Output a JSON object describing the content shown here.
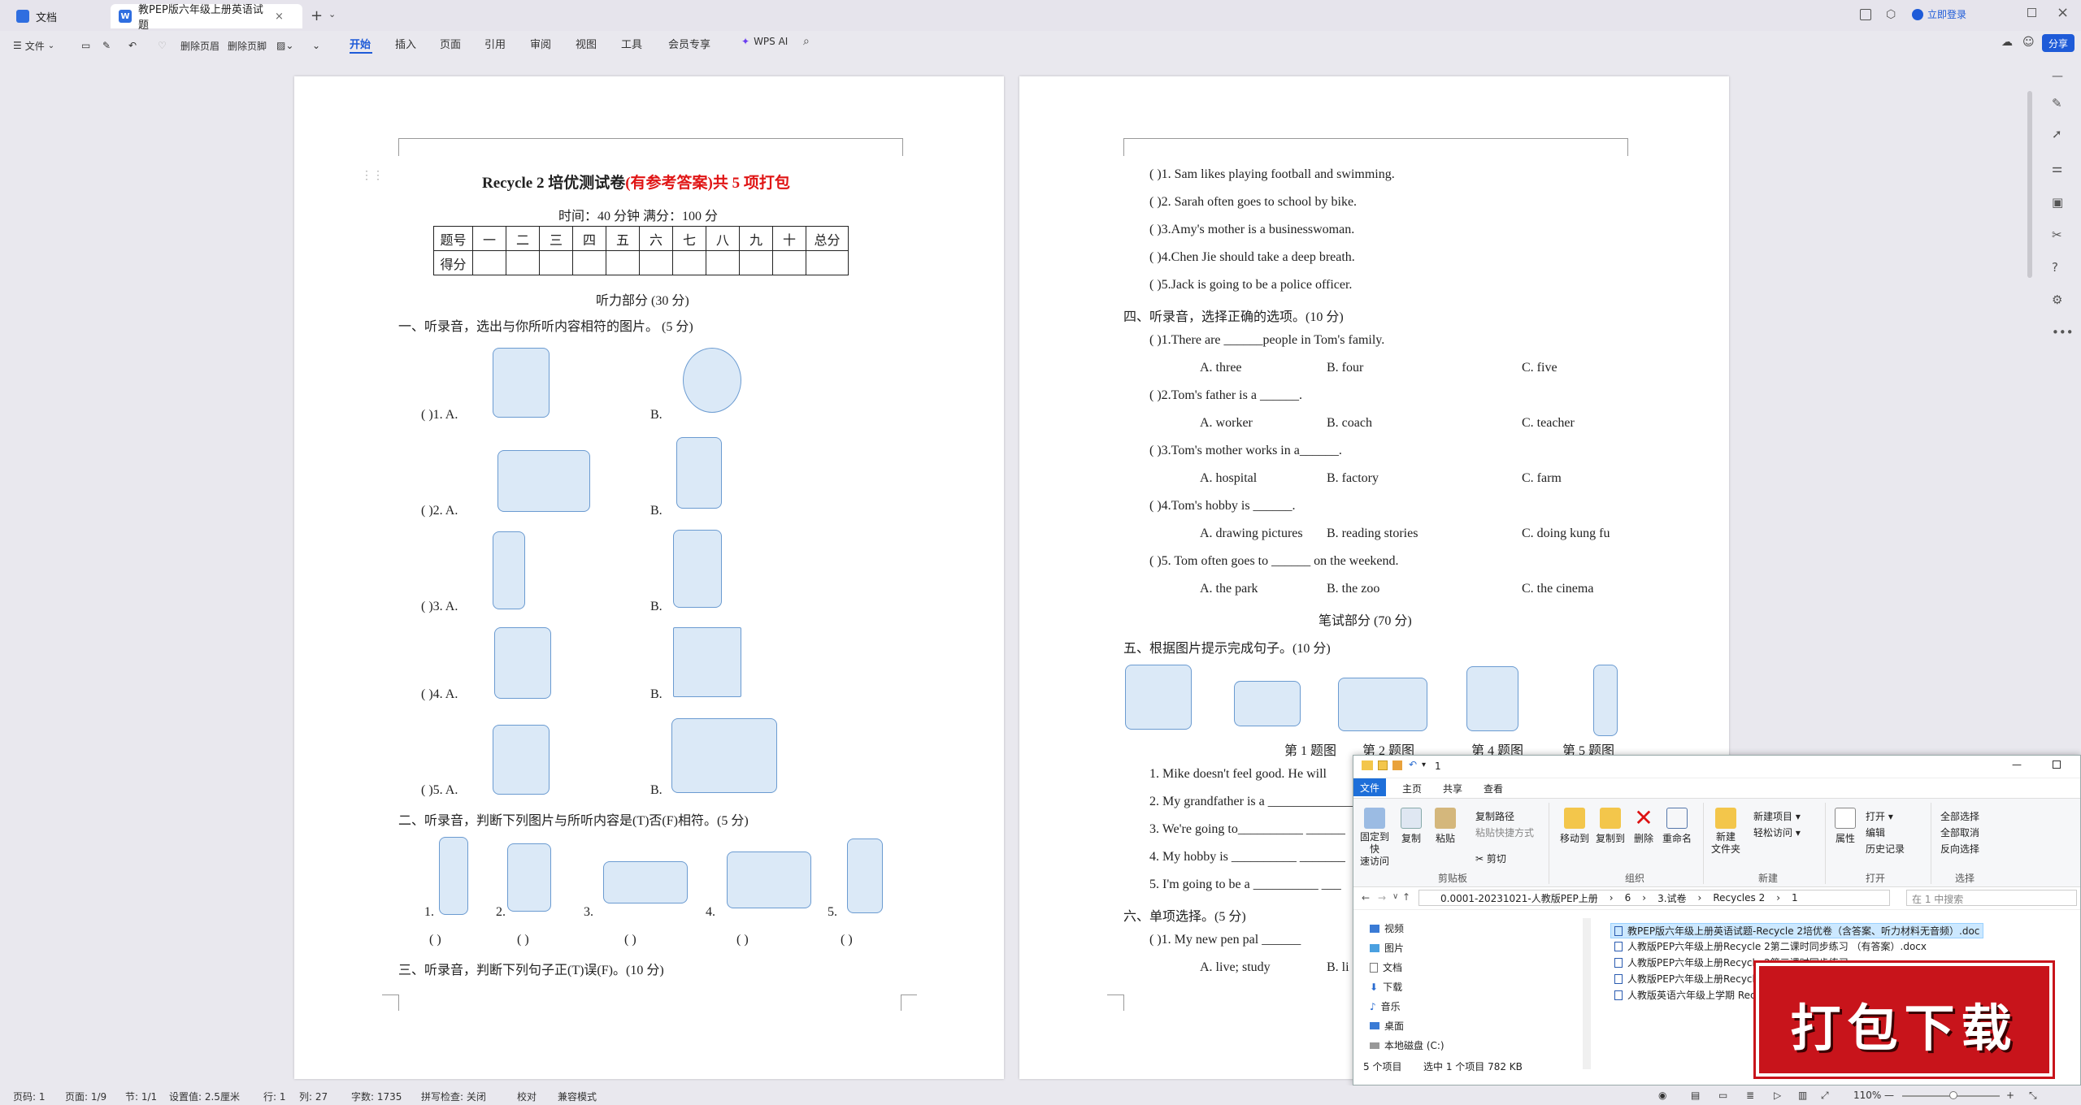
{
  "titlebar": {
    "tabs": [
      {
        "label": "文档"
      },
      {
        "label": "教PEP版六年级上册英语试题"
      }
    ],
    "login_label": "立即登录"
  },
  "toolbar": {
    "file_label": "文件",
    "delete_header": "删除页眉",
    "delete_footer": "删除页脚",
    "ribbon_tabs": [
      "开始",
      "插入",
      "页面",
      "引用",
      "审阅",
      "视图",
      "工具",
      "会员专享"
    ],
    "wps_ai": "WPS AI",
    "share": "分享"
  },
  "page1": {
    "title_black": "Recycle 2 培优测试卷",
    "title_red": "(有参考答案)共 5 项打包",
    "subtitle": "时间：40 分钟    满分：100 分",
    "score_row1": [
      "题号",
      "一",
      "二",
      "三",
      "四",
      "五",
      "六",
      "七",
      "八",
      "九",
      "十",
      "总分"
    ],
    "score_row2": [
      "得分",
      "",
      "",
      "",
      "",
      "",
      "",
      "",
      "",
      "",
      "",
      ""
    ],
    "listening": "听力部分 (30 分)",
    "section1": "一、听录音，选出与你所听内容相符的图片。 (5 分)",
    "q_labels": [
      {
        "a": "(      )1. A.",
        "b": "B."
      },
      {
        "a": "(      )2. A.",
        "b": "B."
      },
      {
        "a": "(      )3. A.",
        "b": "B."
      },
      {
        "a": "(      )4. A.",
        "b": "B."
      },
      {
        "a": "(      )5. A.",
        "b": "B."
      }
    ],
    "section2": "二、听录音，判断下列图片与所听内容是(T)否(F)相符。(5 分)",
    "s2_nums": [
      "1.",
      "2.",
      "3.",
      "4.",
      "5."
    ],
    "s2_paren": "(      )",
    "section3": "三、听录音，判断下列句子正(T)误(F)。(10 分)"
  },
  "page2": {
    "tf": [
      "(        )1. Sam likes playing football and swimming.",
      "(        )2. Sarah often goes to school by bike.",
      "(        )3.Amy's mother is a businesswoman.",
      "(        )4.Chen Jie should take a deep breath.",
      "(        )5.Jack is going to be a police officer."
    ],
    "section4": "四、听录音，选择正确的选项。(10 分)",
    "mc": [
      {
        "q": "(        )1.There are ______people in Tom's family.",
        "a": "A. three",
        "b": "B. four",
        "c": "C. five"
      },
      {
        "q": "(        )2.Tom's father is a ______.",
        "a": "A. worker",
        "b": "B. coach",
        "c": "C. teacher"
      },
      {
        "q": "(        )3.Tom's mother works in a______.",
        "a": "A. hospital",
        "b": "B. factory",
        "c": "C. farm"
      },
      {
        "q": "(        )4.Tom's hobby is ______.",
        "a": "A. drawing pictures",
        "b": "B. reading stories",
        "c": "C. doing kung fu"
      },
      {
        "q": "(        )5. Tom often goes to ______ on the weekend.",
        "a": "A. the park",
        "b": "B. the zoo",
        "c": "C. the cinema"
      }
    ],
    "written": "笔试部分    (70 分)",
    "section5": "五、根据图片提示完成句子。(10 分)",
    "pic_labels": [
      "第 1 题图",
      "第 2 题图",
      "第 4 题图",
      "第 5 题图"
    ],
    "sentences": [
      "1. Mike doesn't feel good. He will",
      "2. My grandfather is a ______________",
      "3. We're going to__________ ______",
      "4. My hobby is __________ _______",
      "5. I'm going to be a __________ ___"
    ],
    "section6": "六、单项选择。(5 分)",
    "s6_q1": "(        )1. My new pen pal ______",
    "s6_opts": [
      "A. live; study",
      "B. li"
    ]
  },
  "explorer": {
    "path_num": "1",
    "tabs": [
      "文件",
      "主页",
      "共享",
      "查看"
    ],
    "buttons": {
      "pin": "固定到快\n速访问",
      "copy": "复制",
      "paste": "粘贴",
      "copy_path": "复制路径",
      "paste_shortcut": "粘贴快捷方式",
      "cut": "剪切",
      "move_to": "移动到",
      "copy_to": "复制到",
      "delete": "删除",
      "rename": "重命名",
      "new_folder": "新建\n文件夹",
      "new_item": "新建项目",
      "easy_access": "轻松访问",
      "properties": "属性",
      "open": "打开",
      "edit": "编辑",
      "history": "历史记录",
      "select_all": "全部选择",
      "select_none": "全部取消",
      "invert": "反向选择"
    },
    "groups": [
      "剪贴板",
      "组织",
      "新建",
      "打开",
      "选择"
    ],
    "address": [
      "0.0001-20231021-人教版PEP上册",
      "6",
      "3.试卷",
      "Recycles 2",
      "1"
    ],
    "search_placeholder": "在 1 中搜索",
    "nav": [
      "视频",
      "图片",
      "文档",
      "下载",
      "音乐",
      "桌面",
      "本地磁盘 (C:)"
    ],
    "files": [
      "教PEP版六年级上册英语试题-Recycle 2培优卷（含答案、听力材料无音频）.doc",
      "人教版PEP六年级上册Recycle 2第二课时同步练习 （有答案）.docx",
      "人教版PEP六年级上册Recycle 2第三课时同步练习",
      "人教版PEP六年级上册Recycle 2",
      "人教版英语六年级上学期 Rec"
    ],
    "status_count": "5 个项目",
    "status_selected": "选中 1 个项目  782 KB"
  },
  "promo": {
    "text": "打包下载"
  },
  "statusbar": {
    "page": "页码: 1",
    "pages": "页面: 1/9",
    "section": "节: 1/1",
    "setting": "设置值: 2.5厘米",
    "row": "行: 1",
    "col": "列: 27",
    "words": "字数: 1735",
    "spell": "拼写检查: 关闭",
    "proof": "校对",
    "compat": "兼容模式",
    "zoom": "110%"
  },
  "colors": {
    "accent": "#1e5bd8",
    "red": "#e01515",
    "promo": "#c8141b"
  }
}
